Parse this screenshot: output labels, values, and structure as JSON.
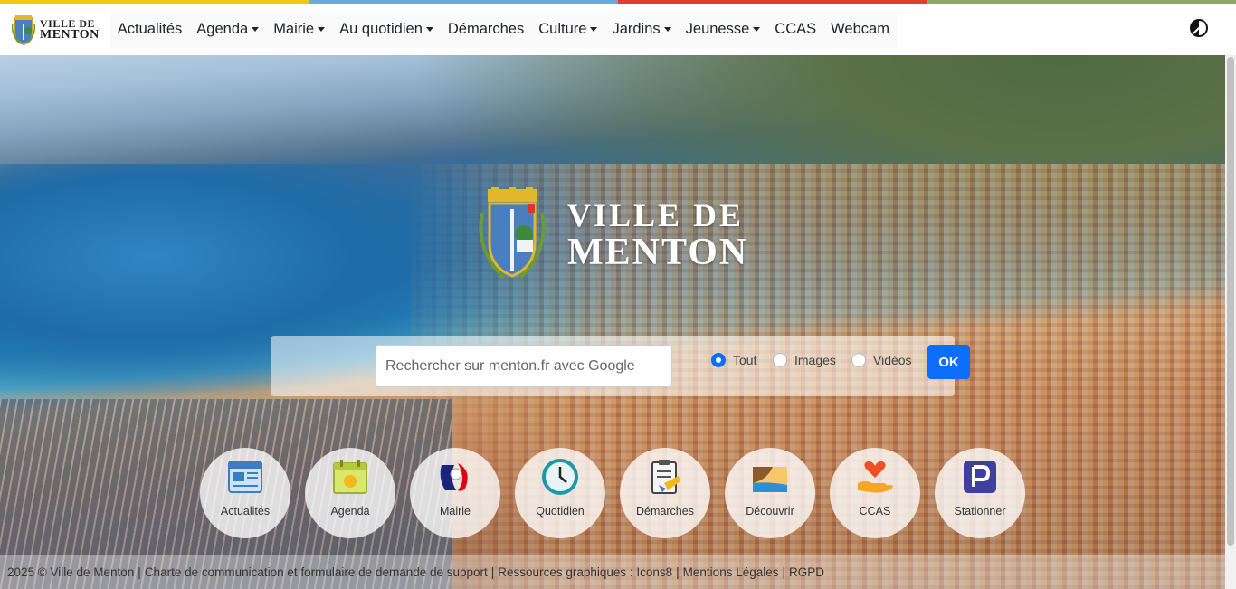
{
  "colors": {
    "stripe": [
      "#f5c518",
      "#6fa6dc",
      "#e0402a",
      "#8fa86a"
    ],
    "accent": "#0d6efd"
  },
  "brand": {
    "line1": "VILLE DE",
    "line2": "MENTON"
  },
  "nav": {
    "items": [
      {
        "label": "Actualités",
        "dropdown": false
      },
      {
        "label": "Agenda",
        "dropdown": true
      },
      {
        "label": "Mairie",
        "dropdown": true
      },
      {
        "label": "Au quotidien",
        "dropdown": true
      },
      {
        "label": "Démarches",
        "dropdown": false
      },
      {
        "label": "Culture",
        "dropdown": true
      },
      {
        "label": "Jardins",
        "dropdown": true
      },
      {
        "label": "Jeunesse",
        "dropdown": true
      },
      {
        "label": "CCAS",
        "dropdown": false
      },
      {
        "label": "Webcam",
        "dropdown": false
      }
    ],
    "theme_icon": "contrast-toggle-icon"
  },
  "hero": {
    "title_line1": "VILLE DE",
    "title_line2": "MENTON"
  },
  "search": {
    "placeholder": "Rechercher sur menton.fr avec Google",
    "value": "",
    "options": [
      {
        "label": "Tout",
        "checked": true
      },
      {
        "label": "Images",
        "checked": false
      },
      {
        "label": "Vidéos",
        "checked": false
      }
    ],
    "submit_label": "OK"
  },
  "quick_links": [
    {
      "label": "Actualités",
      "icon": "newspaper-icon"
    },
    {
      "label": "Agenda",
      "icon": "calendar-icon"
    },
    {
      "label": "Mairie",
      "icon": "marianne-icon"
    },
    {
      "label": "Quotidien",
      "icon": "clock-icon"
    },
    {
      "label": "Démarches",
      "icon": "clipboard-icon"
    },
    {
      "label": "Découvrir",
      "icon": "landscape-icon"
    },
    {
      "label": "CCAS",
      "icon": "heart-hand-icon"
    },
    {
      "label": "Stationner",
      "icon": "parking-icon"
    }
  ],
  "footer": {
    "copyright": "2025 © Ville de Menton",
    "links": [
      "Charte de communication et formulaire de demande de support",
      "Ressources graphiques : Icons8",
      "Mentions Légales",
      "RGPD"
    ]
  }
}
